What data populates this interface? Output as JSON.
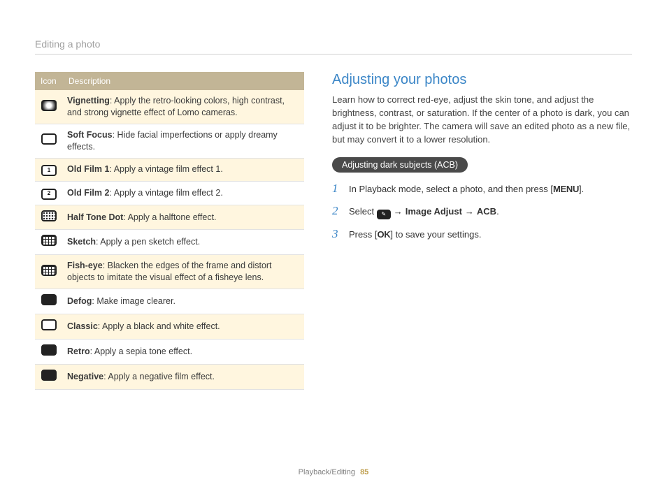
{
  "header": {
    "title": "Editing a photo"
  },
  "table": {
    "headers": {
      "icon": "Icon",
      "desc": "Description"
    },
    "rows": [
      {
        "name": "Vignetting",
        "desc": ": Apply the retro-looking colors, high contrast, and strong vignette effect of Lomo cameras.",
        "highlight": true,
        "iconClass": "vig",
        "iconText": "",
        "iconName": "vignetting-icon"
      },
      {
        "name": "Soft Focus",
        "desc": ": Hide facial imperfections or apply dreamy effects.",
        "highlight": false,
        "iconClass": "",
        "iconText": "",
        "iconName": "soft-focus-icon"
      },
      {
        "name": "Old Film 1",
        "desc": ": Apply a vintage film effect 1.",
        "highlight": true,
        "iconClass": "",
        "iconText": "1",
        "iconName": "old-film-1-icon"
      },
      {
        "name": "Old Film 2",
        "desc": ": Apply a vintage film effect 2.",
        "highlight": false,
        "iconClass": "",
        "iconText": "2",
        "iconName": "old-film-2-icon"
      },
      {
        "name": "Half Tone Dot",
        "desc": ": Apply a halftone effect.",
        "highlight": true,
        "iconClass": "halftone",
        "iconText": "",
        "iconName": "halftone-icon"
      },
      {
        "name": "Sketch",
        "desc": ": Apply a pen sketch effect.",
        "highlight": false,
        "iconClass": "grid",
        "iconText": "",
        "iconName": "sketch-icon"
      },
      {
        "name": "Fish-eye",
        "desc": ": Blacken the edges of the frame and distort objects to imitate the visual effect of a fisheye lens.",
        "highlight": true,
        "iconClass": "grid",
        "iconText": "",
        "iconName": "fisheye-icon"
      },
      {
        "name": "Defog",
        "desc": ": Make image clearer.",
        "highlight": false,
        "iconClass": "dark",
        "iconText": "",
        "iconName": "defog-icon"
      },
      {
        "name": "Classic",
        "desc": ": Apply a black and white effect.",
        "highlight": true,
        "iconClass": "",
        "iconText": "",
        "iconName": "classic-icon"
      },
      {
        "name": "Retro",
        "desc": ": Apply a sepia tone effect.",
        "highlight": false,
        "iconClass": "dark",
        "iconText": "",
        "iconName": "retro-icon"
      },
      {
        "name": "Negative",
        "desc": ": Apply a negative film effect.",
        "highlight": true,
        "iconClass": "dark",
        "iconText": "",
        "iconName": "negative-icon"
      }
    ]
  },
  "right": {
    "title": "Adjusting your photos",
    "intro": "Learn how to correct red-eye, adjust the skin tone, and adjust the brightness, contrast, or saturation. If the center of a photo is dark, you can adjust it to be brighter. The camera will save an edited photo as a new file, but may convert it to a lower resolution.",
    "pill": "Adjusting dark subjects (ACB)",
    "steps": {
      "s1a": "In Playback mode, select a photo, and then press [",
      "s1btn": "MENU",
      "s1b": "].",
      "s2a": "Select ",
      "s2arrow": "→",
      "s2b": "Image Adjust",
      "s2c": "ACB",
      "s2d": ".",
      "s3a": "Press [",
      "s3btn": "OK",
      "s3b": "] to save your settings."
    }
  },
  "footer": {
    "section": "Playback/Editing",
    "page": "85"
  }
}
